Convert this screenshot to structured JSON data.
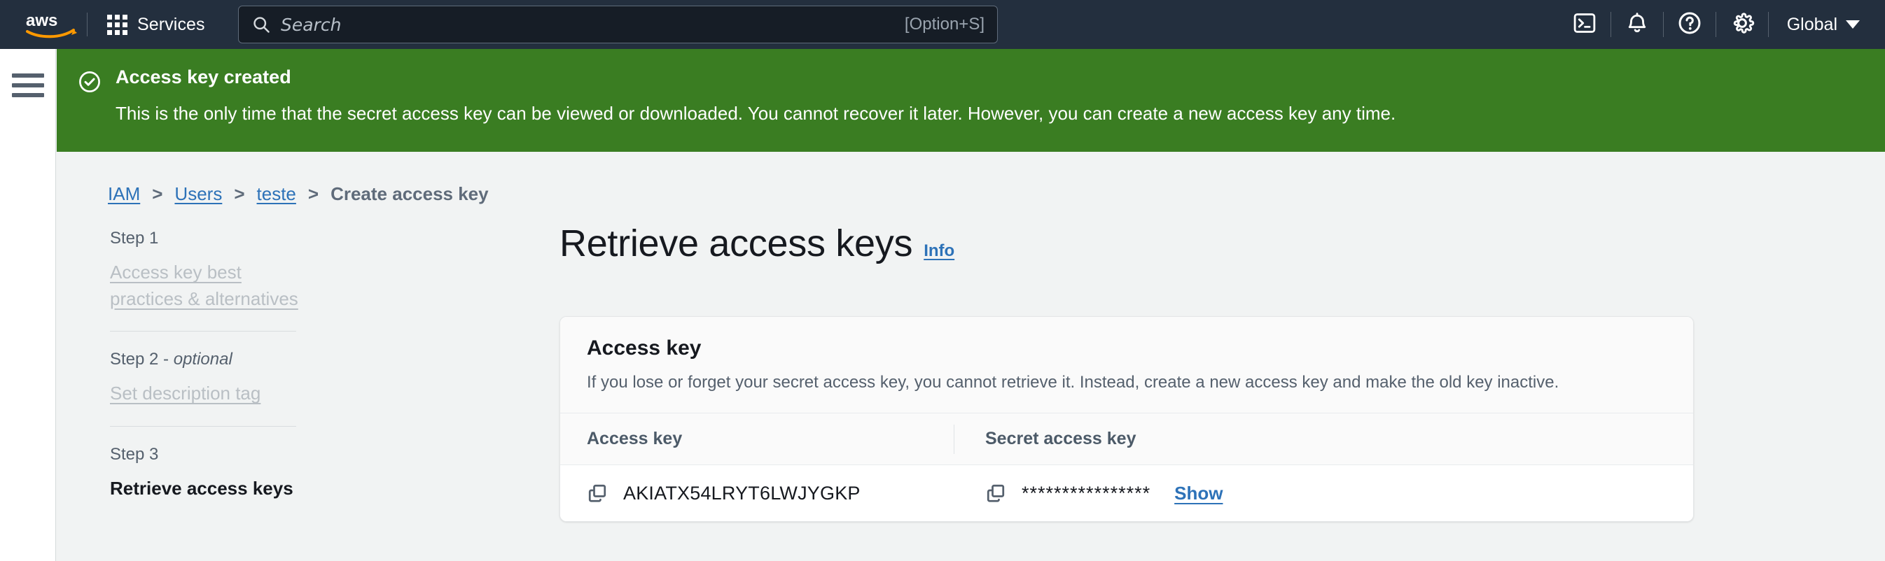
{
  "topnav": {
    "logo_alt": "aws",
    "services_label": "Services",
    "search": {
      "placeholder": "Search",
      "shortcut": "[Option+S]"
    },
    "region_label": "Global",
    "icons": {
      "cloudshell": "cloudshell-icon",
      "notifications": "bell-icon",
      "help": "help-circle-icon",
      "settings": "gear-icon"
    }
  },
  "flash": {
    "title": "Access key created",
    "body": "This is the only time that the secret access key can be viewed or downloaded. You cannot recover it later. However, you can create a new access key any time.",
    "color": "#3a7d22"
  },
  "breadcrumb": {
    "items": [
      {
        "label": "IAM",
        "current": false
      },
      {
        "label": "Users",
        "current": false
      },
      {
        "label": "teste",
        "current": false
      },
      {
        "label": "Create access key",
        "current": true
      }
    ],
    "separator": ">"
  },
  "steps": [
    {
      "step_label": "Step 1",
      "optional": "",
      "title": "Access key best practices & alternatives",
      "state": "done"
    },
    {
      "step_label": "Step 2 - ",
      "optional": "optional",
      "title": "Set description tag",
      "state": "done"
    },
    {
      "step_label": "Step 3",
      "optional": "",
      "title": "Retrieve access keys",
      "state": "current"
    }
  ],
  "main": {
    "title": "Retrieve access keys",
    "info_label": "Info"
  },
  "card": {
    "title": "Access key",
    "description": "If you lose or forget your secret access key, you cannot retrieve it. Instead, create a new access key and make the old key inactive.",
    "columns": {
      "access_key": "Access key",
      "secret_access_key": "Secret access key"
    },
    "row": {
      "access_key_value": "AKIATX54LRYT6LWJYGKP",
      "secret_masked": "****************",
      "show_label": "Show"
    }
  },
  "colors": {
    "nav_bg": "#232f3e",
    "success_green": "#3a7d22",
    "link_blue": "#2d72b8",
    "page_bg": "#f1f3f3"
  }
}
